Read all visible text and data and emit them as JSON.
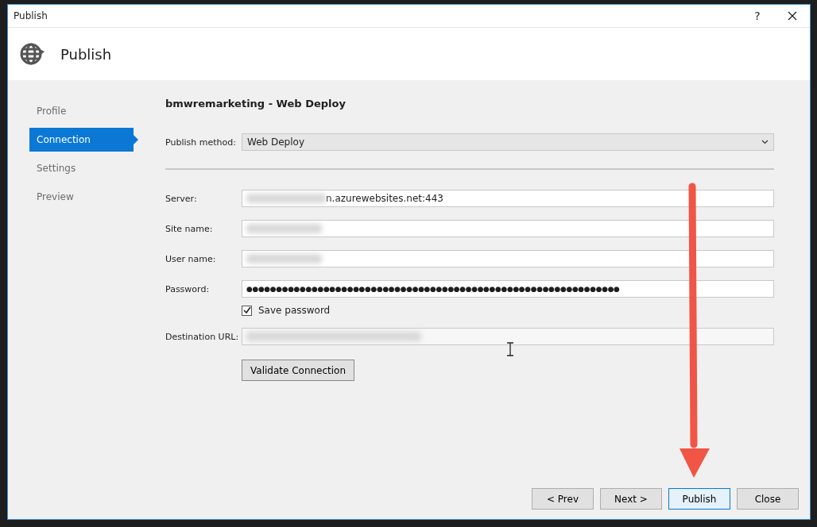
{
  "window": {
    "title": "Publish",
    "help": "?"
  },
  "header": {
    "title": "Publish"
  },
  "sidebar": {
    "items": [
      {
        "label": "Profile",
        "selected": false
      },
      {
        "label": "Connection",
        "selected": true
      },
      {
        "label": "Settings",
        "selected": false
      },
      {
        "label": "Preview",
        "selected": false
      }
    ]
  },
  "content": {
    "title": "bmwremarketing - Web Deploy",
    "publish_method": {
      "label": "Publish method:",
      "value": "Web Deploy"
    },
    "fields": [
      {
        "label": "Server:",
        "kind": "partly_blurred",
        "value": "n.azurewebsites.net:443"
      },
      {
        "label": "Site name:",
        "kind": "blurred"
      },
      {
        "label": "User name:",
        "kind": "blurred"
      },
      {
        "label": "Password:",
        "kind": "password",
        "value": "●●●●●●●●●●●●●●●●●●●●●●●●●●●●●●●●●●●●●●●●●●●●●●●●●●●●●●●●●●●●●●●"
      },
      {
        "label": "Save password",
        "kind": "checkbox",
        "checked": true
      },
      {
        "label": "Destination URL:",
        "kind": "blurred_readonly"
      }
    ],
    "validate_button": "Validate Connection"
  },
  "buttons": [
    {
      "label": "< Prev",
      "selected": false
    },
    {
      "label": "Next >",
      "selected": false
    },
    {
      "label": "Publish",
      "selected": true
    },
    {
      "label": "Close",
      "selected": false
    }
  ]
}
